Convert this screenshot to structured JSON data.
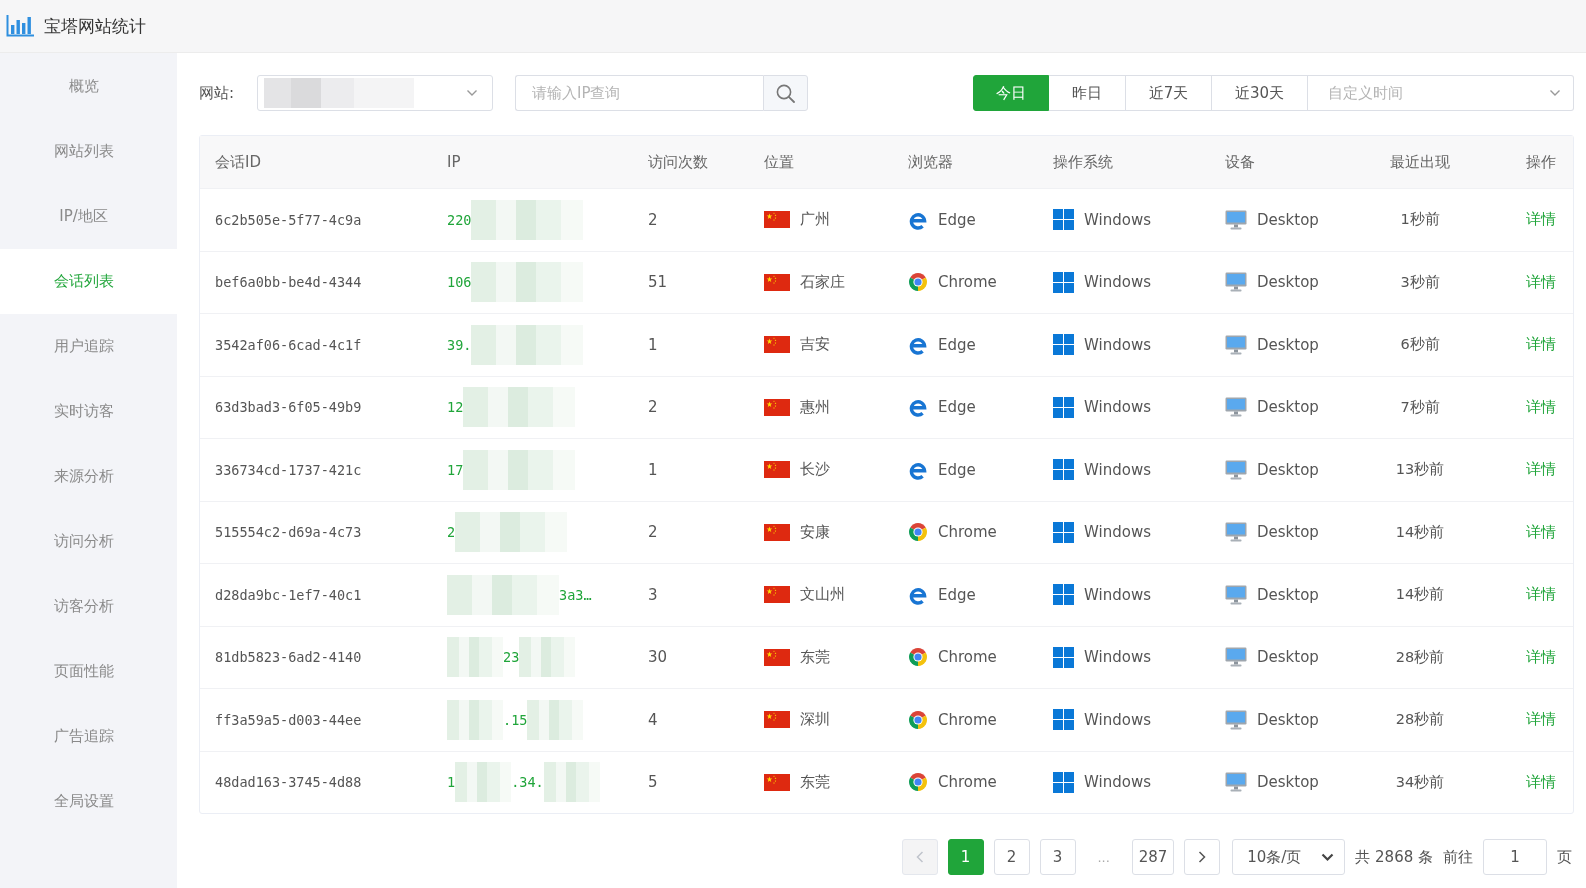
{
  "app": {
    "title": "宝塔网站统计"
  },
  "sidebar": {
    "items": [
      {
        "label": "概览",
        "selected": false
      },
      {
        "label": "网站列表",
        "selected": false
      },
      {
        "label": "IP/地区",
        "selected": false
      },
      {
        "label": "会话列表",
        "selected": true
      },
      {
        "label": "用户追踪",
        "selected": false
      },
      {
        "label": "实时访客",
        "selected": false
      },
      {
        "label": "来源分析",
        "selected": false
      },
      {
        "label": "访问分析",
        "selected": false
      },
      {
        "label": "访客分析",
        "selected": false
      },
      {
        "label": "页面性能",
        "selected": false
      },
      {
        "label": "广告追踪",
        "selected": false
      },
      {
        "label": "全局设置",
        "selected": false
      }
    ]
  },
  "filters": {
    "site": {
      "label": "网站:",
      "value_blurred": true
    },
    "search": {
      "placeholder": "请输入IP查询"
    },
    "date_ranges": [
      {
        "label": "今日",
        "selected": true
      },
      {
        "label": "昨日",
        "selected": false
      },
      {
        "label": "近7天",
        "selected": false
      },
      {
        "label": "近30天",
        "selected": false
      }
    ],
    "custom_range": {
      "placeholder": "自定义时间"
    }
  },
  "table": {
    "columns": [
      "会话ID",
      "IP",
      "访问次数",
      "位置",
      "浏览器",
      "操作系统",
      "设备",
      "最近出现",
      "操作"
    ],
    "rows": [
      {
        "session_id": "6c2b505e-5f77-4c9a",
        "ip": [
          {
            "kind": "text",
            "text": "220"
          },
          {
            "kind": "blur"
          }
        ],
        "visits": "2",
        "location": {
          "kind": "cn",
          "city": "广州"
        },
        "browser": {
          "kind": "edge",
          "name": "Edge"
        },
        "os": {
          "kind": "windows",
          "name": "Windows"
        },
        "device": {
          "kind": "desktop",
          "name": "Desktop"
        },
        "last_seen": "1秒前",
        "action": "详情"
      },
      {
        "session_id": "bef6a0bb-be4d-4344",
        "ip": [
          {
            "kind": "text",
            "text": "106"
          },
          {
            "kind": "blur"
          }
        ],
        "visits": "51",
        "location": {
          "kind": "cn",
          "city": "石家庄"
        },
        "browser": {
          "kind": "chrome",
          "name": "Chrome"
        },
        "os": {
          "kind": "windows",
          "name": "Windows"
        },
        "device": {
          "kind": "desktop",
          "name": "Desktop"
        },
        "last_seen": "3秒前",
        "action": "详情"
      },
      {
        "session_id": "3542af06-6cad-4c1f",
        "ip": [
          {
            "kind": "text",
            "text": "39."
          },
          {
            "kind": "blur"
          }
        ],
        "visits": "1",
        "location": {
          "kind": "cn",
          "city": "吉安"
        },
        "browser": {
          "kind": "edge",
          "name": "Edge"
        },
        "os": {
          "kind": "windows",
          "name": "Windows"
        },
        "device": {
          "kind": "desktop",
          "name": "Desktop"
        },
        "last_seen": "6秒前",
        "action": "详情"
      },
      {
        "session_id": "63d3bad3-6f05-49b9",
        "ip": [
          {
            "kind": "text",
            "text": "12"
          },
          {
            "kind": "blur"
          }
        ],
        "visits": "2",
        "location": {
          "kind": "cn",
          "city": "惠州"
        },
        "browser": {
          "kind": "edge",
          "name": "Edge"
        },
        "os": {
          "kind": "windows",
          "name": "Windows"
        },
        "device": {
          "kind": "desktop",
          "name": "Desktop"
        },
        "last_seen": "7秒前",
        "action": "详情"
      },
      {
        "session_id": "336734cd-1737-421c",
        "ip": [
          {
            "kind": "text",
            "text": "17"
          },
          {
            "kind": "blur"
          }
        ],
        "visits": "1",
        "location": {
          "kind": "cn",
          "city": "长沙"
        },
        "browser": {
          "kind": "edge",
          "name": "Edge"
        },
        "os": {
          "kind": "windows",
          "name": "Windows"
        },
        "device": {
          "kind": "desktop",
          "name": "Desktop"
        },
        "last_seen": "13秒前",
        "action": "详情"
      },
      {
        "session_id": "515554c2-d69a-4c73",
        "ip": [
          {
            "kind": "text",
            "text": "2"
          },
          {
            "kind": "blur"
          }
        ],
        "visits": "2",
        "location": {
          "kind": "cn",
          "city": "安康"
        },
        "browser": {
          "kind": "chrome",
          "name": "Chrome"
        },
        "os": {
          "kind": "windows",
          "name": "Windows"
        },
        "device": {
          "kind": "desktop",
          "name": "Desktop"
        },
        "last_seen": "14秒前",
        "action": "详情"
      },
      {
        "session_id": "d28da9bc-1ef7-40c1",
        "ip": [
          {
            "kind": "blur"
          },
          {
            "kind": "text",
            "text": "3a3…"
          }
        ],
        "visits": "3",
        "location": {
          "kind": "cn",
          "city": "文山州"
        },
        "browser": {
          "kind": "edge",
          "name": "Edge"
        },
        "os": {
          "kind": "windows",
          "name": "Windows"
        },
        "device": {
          "kind": "desktop",
          "name": "Desktop"
        },
        "last_seen": "14秒前",
        "action": "详情"
      },
      {
        "session_id": "81db5823-6ad2-4140",
        "ip": [
          {
            "kind": "blur"
          },
          {
            "kind": "text",
            "text": "23"
          },
          {
            "kind": "blur"
          }
        ],
        "visits": "30",
        "location": {
          "kind": "cn",
          "city": "东莞"
        },
        "browser": {
          "kind": "chrome",
          "name": "Chrome"
        },
        "os": {
          "kind": "windows",
          "name": "Windows"
        },
        "device": {
          "kind": "desktop",
          "name": "Desktop"
        },
        "last_seen": "28秒前",
        "action": "详情"
      },
      {
        "session_id": "ff3a59a5-d003-44ee",
        "ip": [
          {
            "kind": "blur"
          },
          {
            "kind": "text",
            "text": ".15"
          },
          {
            "kind": "blur"
          }
        ],
        "visits": "4",
        "location": {
          "kind": "cn",
          "city": "深圳"
        },
        "browser": {
          "kind": "chrome",
          "name": "Chrome"
        },
        "os": {
          "kind": "windows",
          "name": "Windows"
        },
        "device": {
          "kind": "desktop",
          "name": "Desktop"
        },
        "last_seen": "28秒前",
        "action": "详情"
      },
      {
        "session_id": "48dad163-3745-4d88",
        "ip": [
          {
            "kind": "text",
            "text": "1"
          },
          {
            "kind": "blur"
          },
          {
            "kind": "text",
            "text": ".34."
          },
          {
            "kind": "blur"
          }
        ],
        "visits": "5",
        "location": {
          "kind": "cn",
          "city": "东莞"
        },
        "browser": {
          "kind": "chrome",
          "name": "Chrome"
        },
        "os": {
          "kind": "windows",
          "name": "Windows"
        },
        "device": {
          "kind": "desktop",
          "name": "Desktop"
        },
        "last_seen": "34秒前",
        "action": "详情"
      }
    ]
  },
  "pagination": {
    "prev": {
      "disabled": true
    },
    "pages": [
      {
        "kind": "page",
        "label": "1",
        "selected": true
      },
      {
        "kind": "page",
        "label": "2",
        "selected": false
      },
      {
        "kind": "page",
        "label": "3",
        "selected": false
      },
      {
        "kind": "ellipsis",
        "label": "...",
        "selected": false
      },
      {
        "kind": "page",
        "label": "287",
        "selected": false
      }
    ],
    "next": {
      "disabled": false
    },
    "page_size": "10条/页",
    "total": "共 2868 条",
    "goto_label": "前往",
    "goto_value": "1",
    "goto_suffix": "页"
  }
}
